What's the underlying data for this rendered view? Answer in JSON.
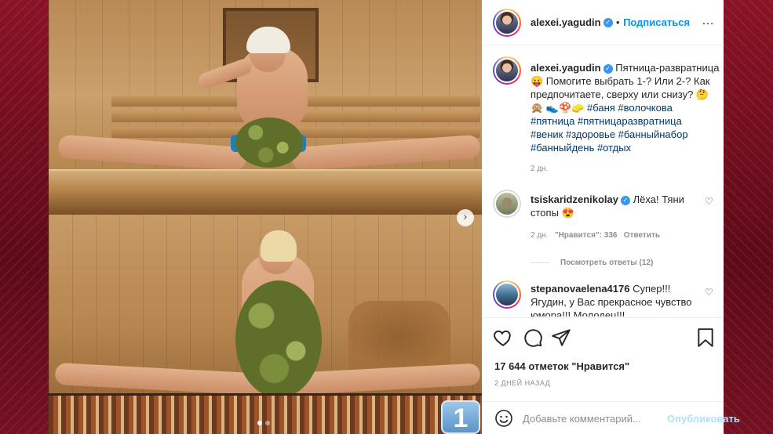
{
  "post": {
    "author": "alexei.yagudin",
    "follow_label": "Подписаться",
    "separator": "•",
    "caption_lines": [
      "Пятница-развратница",
      "😛 Помогите выбрать 1-? Или 2-? Как",
      "предпочитаете, сверху или снизу? 🤔",
      "🙊 👟🍄🧽 #баня #волочкова",
      "#пятница #пятницаразвратница",
      "#веник #здоровье #банныйнабор",
      "#банныйдень #отдых"
    ],
    "caption_age": "2 дн.",
    "likes": "17 644 отметок \"Нравится\"",
    "date_caps": "2 ДНЕЙ НАЗАД"
  },
  "comments": [
    {
      "author": "tsiskaridzenikolay",
      "lines": [
        "Лёха! Тяни",
        "стопы 😍"
      ],
      "age": "2 дн.",
      "likes": "\"Нравится\": 336",
      "reply": "Ответить",
      "view_replies": "Посмотреть ответы (12)"
    },
    {
      "author": "stepanovaelena4176",
      "lines": [
        "Супер!!!",
        "Ягудин, у Вас прекрасное чувство",
        "юмора!!! Молодец!!!"
      ]
    }
  ],
  "composer": {
    "placeholder": "Добавьте комментарий...",
    "publish_label": "Опубликовать"
  },
  "overlay": {
    "slide_number": "1",
    "next_arrow": "›",
    "slides": 2,
    "active_slide": 1
  },
  "icons": {
    "more": "…",
    "like": "heart-icon",
    "comment": "comment-icon",
    "share": "share-icon",
    "save": "bookmark-icon",
    "emoji": "emoji-icon"
  },
  "colors": {
    "link": "#0095f6",
    "hashtag": "#00376b",
    "muted": "#8e8e8e",
    "verified": "#3897f0",
    "publish_disabled": "#b2dffc"
  }
}
